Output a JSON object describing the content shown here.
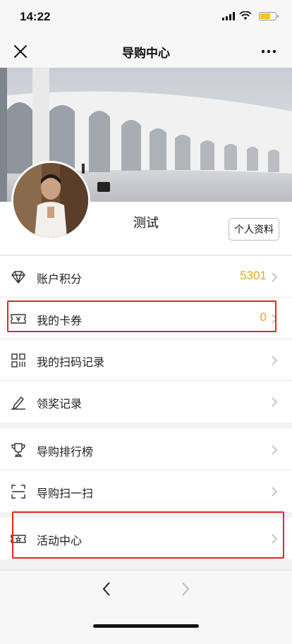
{
  "status_bar": {
    "time": "14:22"
  },
  "nav": {
    "title": "导购中心",
    "close_icon": "close-icon",
    "more_icon": "more-icon"
  },
  "profile": {
    "name": "测试",
    "profile_button": "个人资料"
  },
  "menu_group_1": [
    {
      "label": "账户积分",
      "value": "5301",
      "icon": "diamond-icon"
    },
    {
      "label": "我的卡券",
      "value": "0",
      "icon": "coupon-icon"
    },
    {
      "label": "我的扫码记录",
      "value": "",
      "icon": "qr-icon"
    },
    {
      "label": "领奖记录",
      "value": "",
      "icon": "pen-icon"
    }
  ],
  "menu_group_2": [
    {
      "label": "导购排行榜",
      "value": "",
      "icon": "trophy-icon"
    },
    {
      "label": "导购扫一扫",
      "value": "",
      "icon": "scan-icon"
    }
  ],
  "menu_group_3": [
    {
      "label": "活动中心",
      "value": "",
      "icon": "ticket-icon"
    }
  ],
  "colors": {
    "accent_value": "#e0a824",
    "highlight": "#e5261f"
  }
}
